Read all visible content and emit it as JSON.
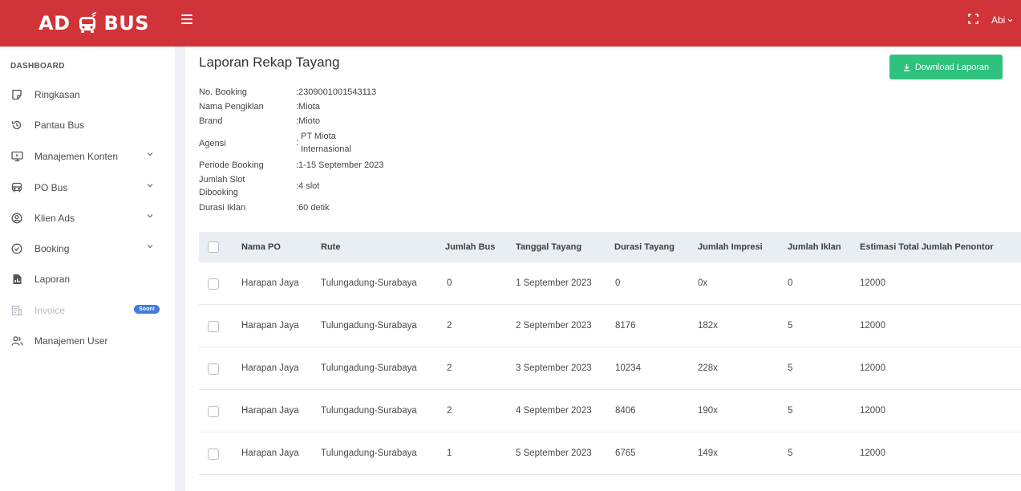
{
  "header": {
    "logo_left": "AD",
    "logo_right": "BUS",
    "user_name": "Abi"
  },
  "sidebar": {
    "heading": "DASHBOARD",
    "items": [
      {
        "label": "Ringkasan",
        "icon": "document-icon"
      },
      {
        "label": "Pantau Bus",
        "icon": "history-icon"
      },
      {
        "label": "Manajemen Konten",
        "icon": "monitor-icon"
      },
      {
        "label": "PO Bus",
        "icon": "bus-icon"
      },
      {
        "label": "Klien Ads",
        "icon": "user-circle-icon"
      },
      {
        "label": "Booking",
        "icon": "check-circle-icon"
      },
      {
        "label": "Laporan",
        "icon": "report-icon"
      },
      {
        "label": "Invoice",
        "icon": "invoice-icon",
        "badge": "Soon!"
      },
      {
        "label": "Manajemen User",
        "icon": "users-icon"
      }
    ]
  },
  "page": {
    "title": "Laporan Rekap Tayang",
    "download_label": "Download Laporan"
  },
  "booking_info": [
    {
      "label": "No. Booking",
      "value": ":2309001001543113"
    },
    {
      "label": "Nama Pengiklan",
      "value": ":Miota"
    },
    {
      "label": "Brand",
      "value": ":Mioto"
    },
    {
      "label": "Agensi",
      "value_line1": "PT Miota",
      "value_line2": "Internasional"
    },
    {
      "label": "Periode Booking",
      "value": ":1-15 September 2023"
    },
    {
      "label_line1": "Jumlah Slot",
      "label_line2": "Dibooking",
      "value": ":4 slot"
    },
    {
      "label": "Durasi Iklan",
      "value": ":60 detik"
    }
  ],
  "table": {
    "columns": [
      "Nama PO",
      "Rute",
      "Jumlah Bus",
      "Tanggal Tayang",
      "Durasi Tayang",
      "Jumlah Impresi",
      "Jumlah Iklan",
      "Estimasi Total Jumlah Penontor"
    ],
    "rows": [
      [
        "Harapan Jaya",
        "Tulungadung-Surabaya",
        "0",
        "1 September 2023",
        "0",
        "0x",
        "0",
        "12000"
      ],
      [
        "Harapan Jaya",
        "Tulungadung-Surabaya",
        "2",
        "2 September 2023",
        "8176",
        "182x",
        "5",
        "12000"
      ],
      [
        "Harapan Jaya",
        "Tulungadung-Surabaya",
        "2",
        "3 September 2023",
        "10234",
        "228x",
        "5",
        "12000"
      ],
      [
        "Harapan Jaya",
        "Tulungadung-Surabaya",
        "2",
        "4 September 2023",
        "8406",
        "190x",
        "5",
        "12000"
      ],
      [
        "Harapan Jaya",
        "Tulungadung-Surabaya",
        "1",
        "5 September 2023",
        "6765",
        "149x",
        "5",
        "12000"
      ]
    ]
  },
  "colors": {
    "topbar": "#d13438",
    "download_button": "#2ec27e",
    "badge": "#3d7de0",
    "table_header": "#e9edf4"
  }
}
